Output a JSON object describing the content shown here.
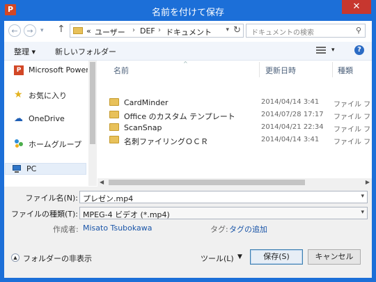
{
  "window": {
    "app_icon_letter": "P",
    "title": "名前を付けて保存",
    "close_glyph": "✕"
  },
  "address": {
    "back_glyph": "←",
    "forward_glyph": "→",
    "up_glyph": "↑",
    "crumb_prefix": "«",
    "crumbs": [
      "ユーザー",
      "DEF",
      "ドキュメント"
    ],
    "separator": "›",
    "refresh_glyph": "↻"
  },
  "search": {
    "placeholder": "ドキュメントの検索"
  },
  "toolbar": {
    "organize_label": "整理 ▾",
    "new_folder_label": "新しいフォルダー",
    "view_dropdown": "▾",
    "help_label": "?"
  },
  "nav": {
    "items": [
      {
        "label": "Microsoft PowerP",
        "icon": "powerpoint-icon"
      },
      {
        "label": "お気に入り",
        "icon": "star-icon"
      },
      {
        "label": "OneDrive",
        "icon": "cloud-icon"
      },
      {
        "label": "ホームグループ",
        "icon": "homegroup-icon"
      },
      {
        "label": "PC",
        "icon": "computer-icon"
      }
    ]
  },
  "filelist": {
    "columns": {
      "name": "名前",
      "date": "更新日時",
      "type": "種類"
    },
    "sort_glyph": "^",
    "rows": [
      {
        "name": "CardMinder",
        "date": "2014/04/14 3:41",
        "type": "ファイル フォル"
      },
      {
        "name": "Office のカスタム テンプレート",
        "date": "2014/07/28 17:17",
        "type": "ファイル フォル"
      },
      {
        "name": "ScanSnap",
        "date": "2014/04/21 22:34",
        "type": "ファイル フォル"
      },
      {
        "name": "名刺ファイリングＯＣＲ",
        "date": "2014/04/14 3:41",
        "type": "ファイル フォル"
      }
    ]
  },
  "form": {
    "filename_label": "ファイル名(N):",
    "filename_value": "プレゼン.mp4",
    "filetype_label": "ファイルの種類(T):",
    "filetype_value": "MPEG-4 ビデオ (*.mp4)",
    "author_label": "作成者:",
    "author_value": "Misato Tsubokawa",
    "tags_label": "タグ:",
    "tags_value": "タグの追加"
  },
  "footer": {
    "hide_folders_label": "フォルダーの非表示",
    "hide_glyph": "▲",
    "tools_label": "ツール(L)",
    "tools_dropdown": "▼",
    "save_label": "保存(S)",
    "cancel_label": "キャンセル"
  },
  "colors": {
    "title_bar": "#1c6fd8",
    "close_button": "#c7372f",
    "link_text": "#1a55a8",
    "folder": "#e8c15a"
  }
}
